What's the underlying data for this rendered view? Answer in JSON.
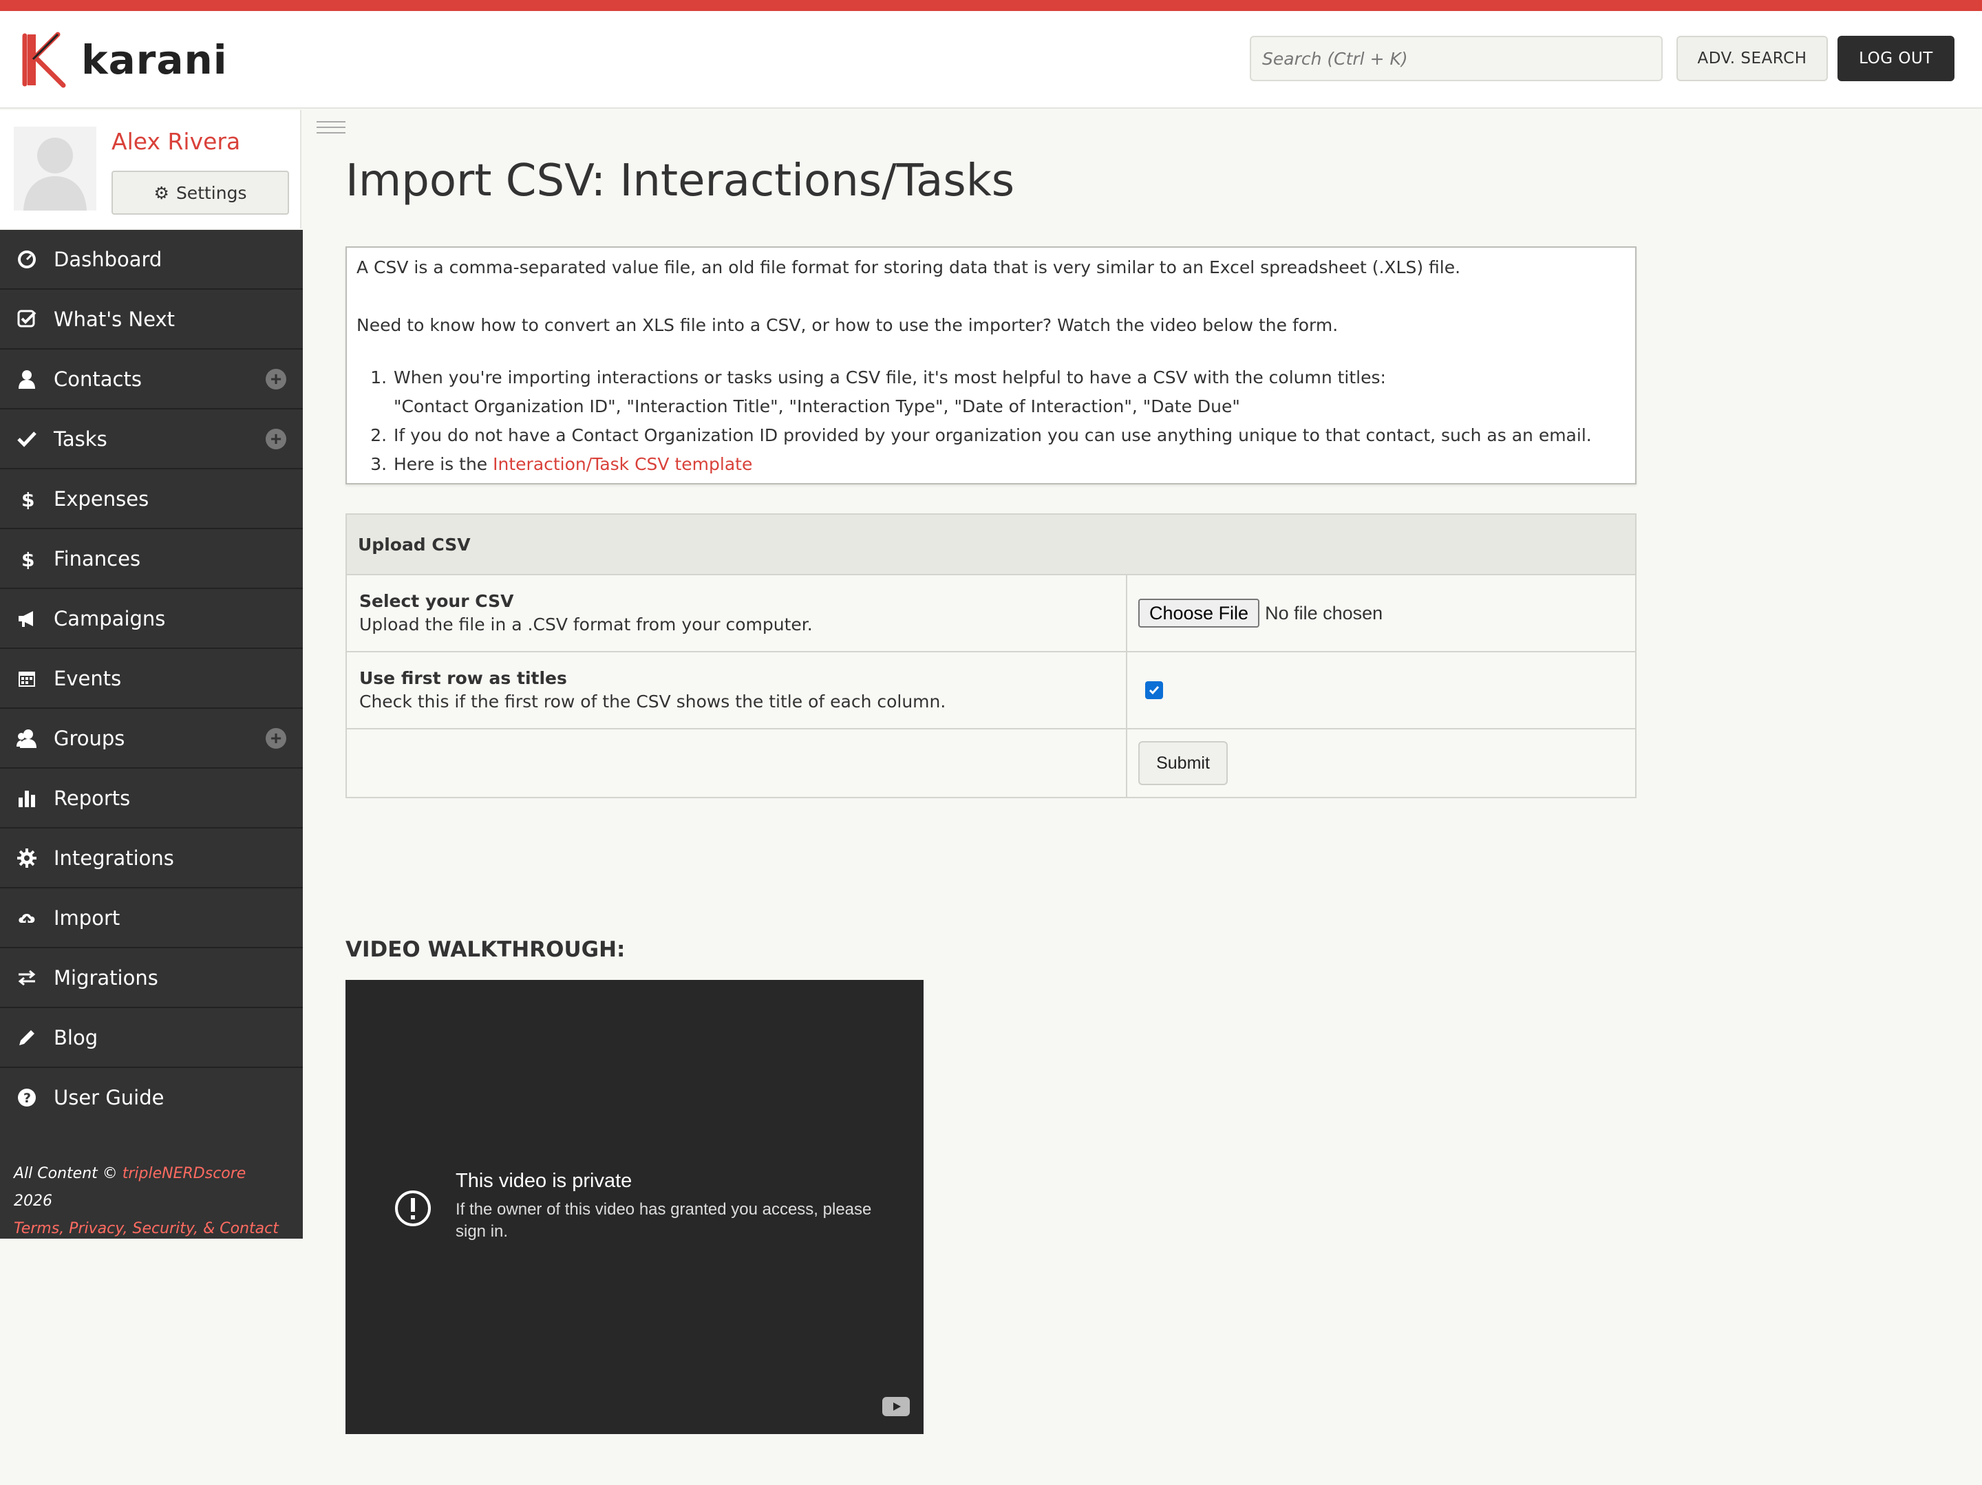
{
  "app": {
    "logo_text": "karani"
  },
  "header": {
    "search_placeholder": "Search (Ctrl + K)",
    "adv_search_label": "ADV. SEARCH",
    "logout_label": "LOG OUT"
  },
  "profile": {
    "name": "Alex Rivera",
    "settings_label": "Settings"
  },
  "nav": [
    {
      "label": "Dashboard",
      "icon": "dashboard-icon",
      "has_add": false
    },
    {
      "label": "What's Next",
      "icon": "check-square-icon",
      "has_add": false
    },
    {
      "label": "Contacts",
      "icon": "user-icon",
      "has_add": true
    },
    {
      "label": "Tasks",
      "icon": "check-icon",
      "has_add": true
    },
    {
      "label": "Expenses",
      "icon": "dollar-icon",
      "has_add": false
    },
    {
      "label": "Finances",
      "icon": "dollar-icon",
      "has_add": false
    },
    {
      "label": "Campaigns",
      "icon": "megaphone-icon",
      "has_add": false
    },
    {
      "label": "Events",
      "icon": "calendar-icon",
      "has_add": false
    },
    {
      "label": "Groups",
      "icon": "group-icon",
      "has_add": true
    },
    {
      "label": "Reports",
      "icon": "bar-chart-icon",
      "has_add": false
    },
    {
      "label": "Integrations",
      "icon": "gear-icon",
      "has_add": false
    },
    {
      "label": "Import",
      "icon": "cloud-upload-icon",
      "has_add": false
    },
    {
      "label": "Migrations",
      "icon": "exchange-icon",
      "has_add": false
    },
    {
      "label": "Blog",
      "icon": "pencil-icon",
      "has_add": false
    },
    {
      "label": "User Guide",
      "icon": "question-circle-icon",
      "has_add": false
    }
  ],
  "footer": {
    "prefix": "All Content ©",
    "brand": "tripleNERDscore",
    "year": "2026",
    "links": "Terms, Privacy, Security, & Contact"
  },
  "main": {
    "title": "Import CSV: Interactions/Tasks",
    "intro_1": "A CSV is a comma-separated value file, an old file format for storing data that is very similar to an Excel spreadsheet (.XLS) file.",
    "intro_2": "Need to know how to convert an XLS file into a CSV, or how to use the importer? Watch the video below the form.",
    "steps": {
      "step1_line1": "When you're importing interactions or tasks using a CSV file, it's most helpful to have a CSV with the column titles:",
      "step1_line2": "\"Contact Organization ID\", \"Interaction Title\", \"Interaction Type\", \"Date of Interaction\", \"Date Due\"",
      "step2": "If you do not have a Contact Organization ID provided by your organization you can use anything unique to that contact, such as an email.",
      "step3_prefix": "Here is the ",
      "step3_link": "Interaction/Task CSV template"
    }
  },
  "upload": {
    "heading": "Upload CSV",
    "select_title": "Select your CSV",
    "select_desc": "Upload the file in a .CSV format from your computer.",
    "choose_file_label": "Choose File",
    "file_status": "No file chosen",
    "first_row_title": "Use first row as titles",
    "first_row_desc": "Check this if the first row of the CSV shows the title of each column.",
    "first_row_checked": true,
    "submit_label": "Submit"
  },
  "video": {
    "heading": "VIDEO WALKTHROUGH:",
    "title": "This video is private",
    "message": "If the owner of this video has granted you access, please sign in."
  },
  "colors": {
    "accent": "#d9413a",
    "sidebar": "#333333",
    "background": "#f7f7f3"
  }
}
